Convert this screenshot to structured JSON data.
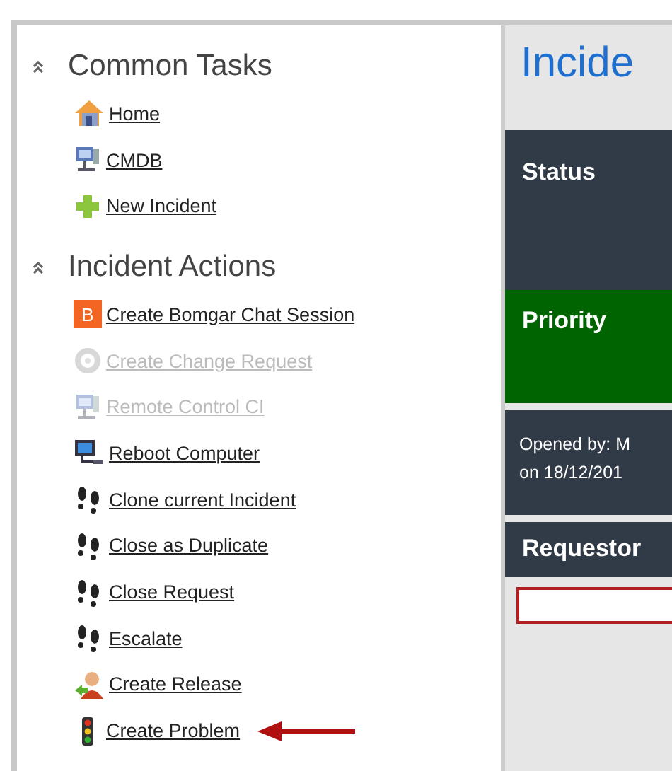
{
  "sidebar": {
    "sections": [
      {
        "title": "Common Tasks",
        "expanded": true,
        "items": [
          {
            "label": "Home",
            "kind": "home",
            "disabled": false
          },
          {
            "label": "CMDB",
            "kind": "computer",
            "disabled": false
          },
          {
            "label": "New Incident",
            "kind": "plus",
            "disabled": false
          }
        ]
      },
      {
        "title": "Incident Actions",
        "expanded": true,
        "items": [
          {
            "label": "Create Bomgar Chat Session",
            "kind": "letter",
            "icon_text": "B",
            "disabled": false
          },
          {
            "label": "Create Change Request",
            "kind": "cycle",
            "disabled": true
          },
          {
            "label": "Remote Control CI",
            "kind": "computer",
            "disabled": true
          },
          {
            "label": "Reboot Computer",
            "kind": "monitor",
            "disabled": false
          },
          {
            "label": "Clone current Incident",
            "kind": "footsteps",
            "disabled": false
          },
          {
            "label": "Close as Duplicate",
            "kind": "footsteps",
            "disabled": false
          },
          {
            "label": "Close Request",
            "kind": "footsteps",
            "disabled": false
          },
          {
            "label": "Escalate",
            "kind": "footsteps",
            "disabled": false
          },
          {
            "label": "Create Release",
            "kind": "person",
            "disabled": false
          },
          {
            "label": "Create Problem",
            "kind": "traffic-light",
            "disabled": false,
            "pointed_at": true
          }
        ]
      }
    ]
  },
  "form": {
    "title": "Incide",
    "status": {
      "label": "Status"
    },
    "priority": {
      "label": "Priority",
      "color": "#006400"
    },
    "opened": {
      "lines": [
        "Opened by: M",
        "on 18/12/201"
      ]
    },
    "requestor": {
      "label": "Requestor"
    }
  }
}
